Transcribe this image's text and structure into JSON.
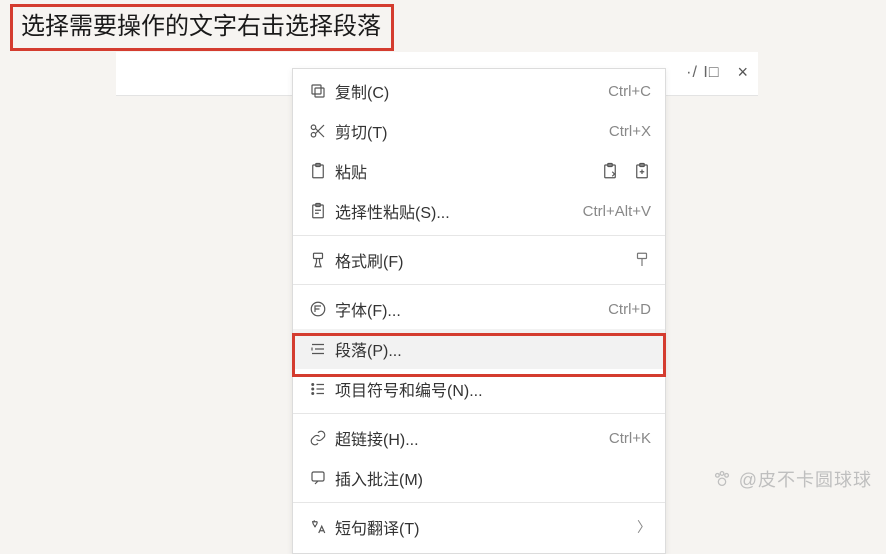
{
  "instruction": "选择需要操作的文字右击选择段落",
  "topbar": {
    "label": "·/ I□",
    "close": "×"
  },
  "menu": {
    "copy": {
      "label": "复制(C)",
      "shortcut": "Ctrl+C"
    },
    "cut": {
      "label": "剪切(T)",
      "shortcut": "Ctrl+X"
    },
    "paste": {
      "label": "粘贴",
      "shortcut": ""
    },
    "pasteSpec": {
      "label": "选择性粘贴(S)...",
      "shortcut": "Ctrl+Alt+V"
    },
    "formatP": {
      "label": "格式刷(F)",
      "shortcut": ""
    },
    "font": {
      "label": "字体(F)...",
      "shortcut": "Ctrl+D"
    },
    "paragraph": {
      "label": "段落(P)...",
      "shortcut": ""
    },
    "bullets": {
      "label": "项目符号和编号(N)...",
      "shortcut": ""
    },
    "hyperlink": {
      "label": "超链接(H)...",
      "shortcut": "Ctrl+K"
    },
    "comment": {
      "label": "插入批注(M)",
      "shortcut": ""
    },
    "translate": {
      "label": "短句翻译(T)",
      "shortcut": ""
    }
  },
  "watermark": {
    "handle": "@皮不卡圆球球"
  }
}
